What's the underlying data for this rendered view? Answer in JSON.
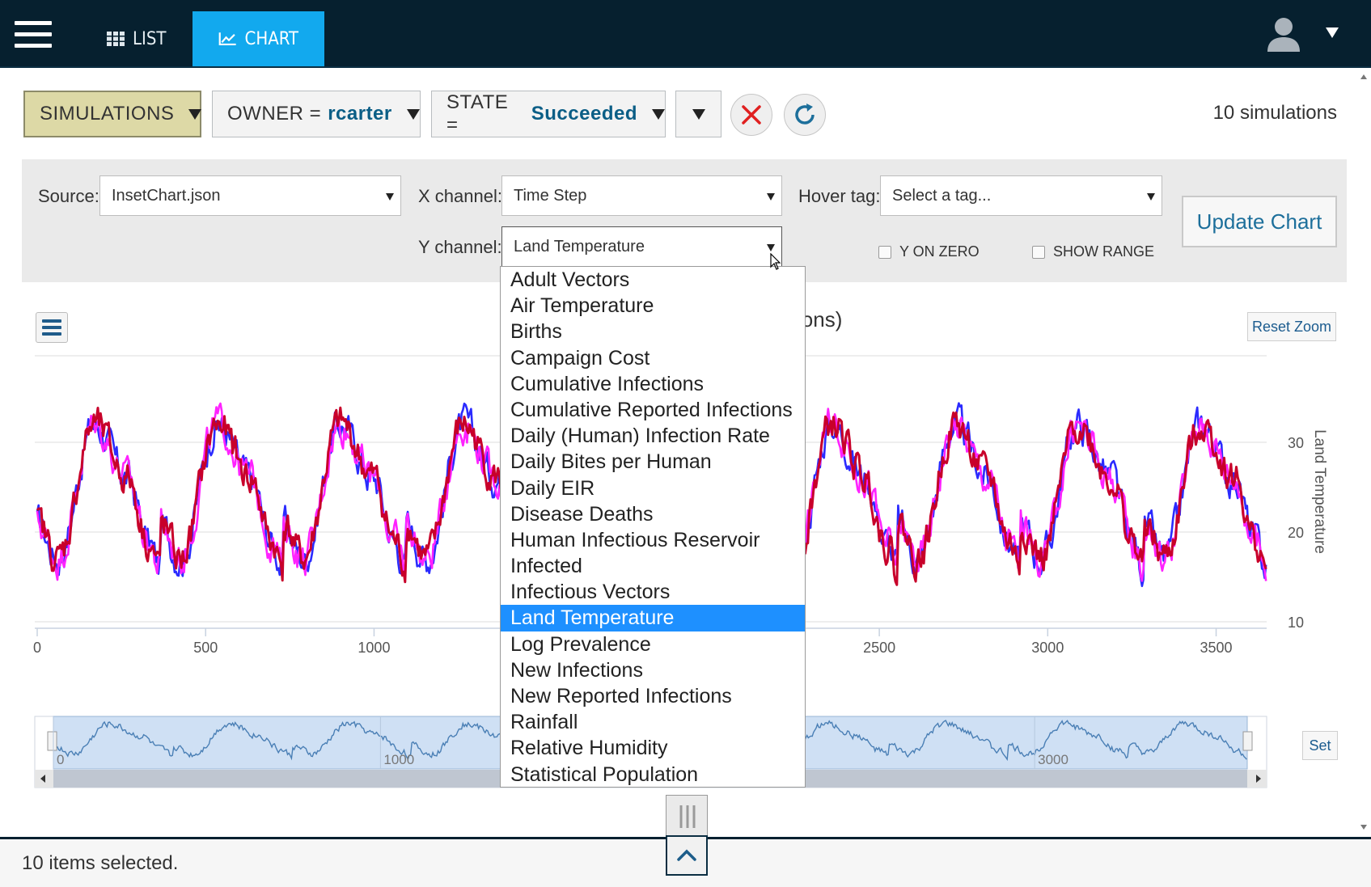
{
  "nav": {
    "tabs": [
      {
        "label": "LIST",
        "icon": "grid-icon"
      },
      {
        "label": "CHART",
        "icon": "chart-line-icon",
        "active": true
      }
    ],
    "user_icon": "user-icon"
  },
  "filters": {
    "simulations_label": "SIMULATIONS",
    "owner_key": "OWNER =",
    "owner_value": "rcarter",
    "state_key": "STATE =",
    "state_value": "Succeeded",
    "clear_icon": "close-icon",
    "refresh_icon": "refresh-icon",
    "count": "10 simulations"
  },
  "settings": {
    "source_label": "Source:",
    "source_value": "InsetChart.json",
    "x_label": "X channel:",
    "x_value": "Time Step",
    "hover_label": "Hover tag:",
    "hover_value": "Select a tag...",
    "y_label": "Y channel:",
    "y_value": "Land Temperature",
    "y_on_zero": "Y ON ZERO",
    "show_range": "SHOW RANGE",
    "update_label": "Update Chart"
  },
  "chart": {
    "title_fragment": "ions)",
    "reset_zoom": "Reset Zoom",
    "set_label": "Set",
    "y_axis_label": "Land Temperature",
    "x_ticks": [
      "0",
      "500",
      "1000",
      "2500",
      "3000",
      "3500"
    ],
    "y_ticks": [
      "30",
      "20",
      "10"
    ],
    "navigator_ticks": [
      "0",
      "1000",
      "3000"
    ]
  },
  "chart_data": {
    "type": "line",
    "ylabel": "Land Temperature",
    "xlim": [
      0,
      3650
    ],
    "ylim": [
      10,
      30
    ],
    "x_ticks": [
      0,
      500,
      1000,
      2500,
      3000,
      3500
    ],
    "y_ticks": [
      10,
      20,
      30
    ],
    "series": [
      {
        "color": "#2b2bff"
      },
      {
        "color": "#ff22ff"
      },
      {
        "color": "#c8002a"
      }
    ],
    "annual_profile": [
      {
        "day": 0,
        "value": 21
      },
      {
        "day": 60,
        "value": 17
      },
      {
        "day": 170,
        "value": 32
      },
      {
        "day": 270,
        "value": 26
      },
      {
        "day": 330,
        "value": 19
      },
      {
        "day": 365,
        "value": 16
      }
    ]
  },
  "dropdown": {
    "items": [
      "Adult Vectors",
      "Air Temperature",
      "Births",
      "Campaign Cost",
      "Cumulative Infections",
      "Cumulative Reported Infections",
      "Daily (Human) Infection Rate",
      "Daily Bites per Human",
      "Daily EIR",
      "Disease Deaths",
      "Human Infectious Reservoir",
      "Infected",
      "Infectious Vectors",
      "Land Temperature",
      "Log Prevalence",
      "New Infections",
      "New Reported Infections",
      "Rainfall",
      "Relative Humidity",
      "Statistical Population"
    ],
    "selected_index": 13
  },
  "footer": {
    "status": "10 items selected."
  }
}
